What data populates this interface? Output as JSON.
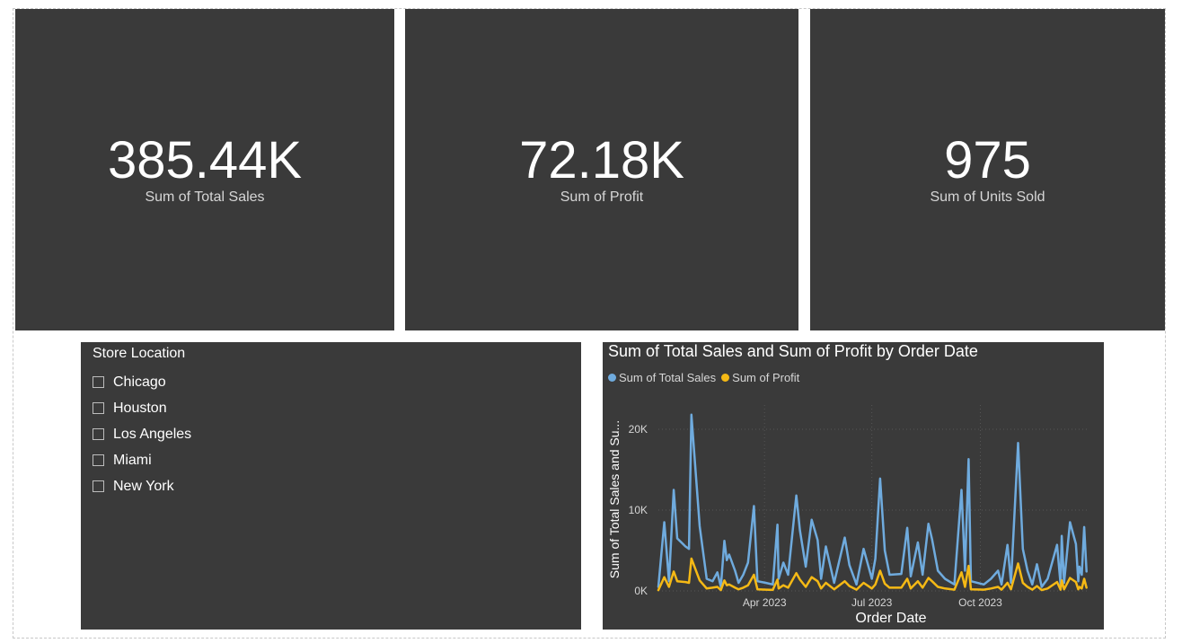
{
  "kpis": [
    {
      "value": "385.44K",
      "label": "Sum of Total Sales"
    },
    {
      "value": "72.18K",
      "label": "Sum of Profit"
    },
    {
      "value": "975",
      "label": "Sum of Units Sold"
    }
  ],
  "slicer": {
    "title": "Store Location",
    "items": [
      "Chicago",
      "Houston",
      "Los Angeles",
      "Miami",
      "New York"
    ]
  },
  "chart": {
    "title": "Sum of Total Sales and Sum of Profit by Order Date",
    "legend": [
      {
        "name": "Sum of Total Sales",
        "color": "#6fabde"
      },
      {
        "name": "Sum of Profit",
        "color": "#f5b915"
      }
    ]
  },
  "chart_data": {
    "type": "line",
    "title": "Sum of Total Sales and Sum of Profit by Order Date",
    "xlabel": "Order Date",
    "ylabel": "Sum of Total Sales and Su...",
    "x_ticks": [
      "Apr 2023",
      "Jul 2023",
      "Oct 2023"
    ],
    "y_ticks": [
      "0K",
      "10K",
      "20K"
    ],
    "ylim": [
      0,
      23000
    ],
    "grid": true,
    "legend_position": "top-left",
    "series": [
      {
        "name": "Sum of Total Sales",
        "color": "#6fabde",
        "points": [
          [
            "2023-01-01",
            500
          ],
          [
            "2023-01-06",
            8500
          ],
          [
            "2023-01-10",
            1200
          ],
          [
            "2023-01-14",
            12500
          ],
          [
            "2023-01-17",
            6500
          ],
          [
            "2023-01-24",
            5500
          ],
          [
            "2023-01-27",
            5200
          ],
          [
            "2023-01-29",
            21800
          ],
          [
            "2023-02-05",
            8000
          ],
          [
            "2023-02-11",
            1500
          ],
          [
            "2023-02-16",
            1200
          ],
          [
            "2023-02-20",
            2300
          ],
          [
            "2023-02-23",
            500
          ],
          [
            "2023-02-26",
            6200
          ],
          [
            "2023-02-28",
            3800
          ],
          [
            "2023-03-02",
            4500
          ],
          [
            "2023-03-07",
            2500
          ],
          [
            "2023-03-10",
            1000
          ],
          [
            "2023-03-14",
            2000
          ],
          [
            "2023-03-18",
            3500
          ],
          [
            "2023-03-23",
            10500
          ],
          [
            "2023-03-26",
            1200
          ],
          [
            "2023-04-02",
            1000
          ],
          [
            "2023-04-08",
            800
          ],
          [
            "2023-04-12",
            8200
          ],
          [
            "2023-04-13",
            1500
          ],
          [
            "2023-04-17",
            3500
          ],
          [
            "2023-04-21",
            2000
          ],
          [
            "2023-04-28",
            11800
          ],
          [
            "2023-05-01",
            7500
          ],
          [
            "2023-05-06",
            3000
          ],
          [
            "2023-05-11",
            8800
          ],
          [
            "2023-05-16",
            6300
          ],
          [
            "2023-05-19",
            1500
          ],
          [
            "2023-05-23",
            5500
          ],
          [
            "2023-05-30",
            1000
          ],
          [
            "2023-06-08",
            6600
          ],
          [
            "2023-06-12",
            3200
          ],
          [
            "2023-06-18",
            800
          ],
          [
            "2023-06-24",
            5200
          ],
          [
            "2023-07-01",
            1500
          ],
          [
            "2023-07-04",
            4000
          ],
          [
            "2023-07-08",
            13900
          ],
          [
            "2023-07-12",
            5000
          ],
          [
            "2023-07-16",
            2000
          ],
          [
            "2023-07-26",
            2100
          ],
          [
            "2023-07-31",
            7800
          ],
          [
            "2023-08-03",
            1800
          ],
          [
            "2023-08-09",
            6000
          ],
          [
            "2023-08-13",
            2000
          ],
          [
            "2023-08-18",
            8300
          ],
          [
            "2023-08-21",
            6400
          ],
          [
            "2023-08-26",
            2500
          ],
          [
            "2023-09-01",
            1500
          ],
          [
            "2023-09-09",
            800
          ],
          [
            "2023-09-15",
            12500
          ],
          [
            "2023-09-18",
            2500
          ],
          [
            "2023-09-21",
            16300
          ],
          [
            "2023-09-23",
            1200
          ],
          [
            "2023-10-04",
            800
          ],
          [
            "2023-10-10",
            1500
          ],
          [
            "2023-10-16",
            2500
          ],
          [
            "2023-10-19",
            800
          ],
          [
            "2023-10-24",
            5700
          ],
          [
            "2023-10-27",
            1000
          ],
          [
            "2023-11-02",
            18300
          ],
          [
            "2023-11-06",
            5200
          ],
          [
            "2023-11-10",
            2500
          ],
          [
            "2023-11-14",
            800
          ],
          [
            "2023-11-18",
            3300
          ],
          [
            "2023-11-22",
            500
          ],
          [
            "2023-11-27",
            1500
          ],
          [
            "2023-12-05",
            5700
          ],
          [
            "2023-12-08",
            800
          ],
          [
            "2023-12-09",
            6800
          ],
          [
            "2023-12-11",
            1000
          ],
          [
            "2023-12-16",
            8500
          ],
          [
            "2023-12-21",
            5800
          ],
          [
            "2023-12-23",
            1200
          ],
          [
            "2023-12-24",
            3000
          ],
          [
            "2023-12-26",
            2000
          ],
          [
            "2023-12-28",
            7900
          ],
          [
            "2023-12-30",
            2400
          ]
        ]
      },
      {
        "name": "Sum of Profit",
        "color": "#f5b915",
        "points": [
          [
            "2023-01-01",
            100
          ],
          [
            "2023-01-06",
            1700
          ],
          [
            "2023-01-10",
            500
          ],
          [
            "2023-01-14",
            2400
          ],
          [
            "2023-01-17",
            1200
          ],
          [
            "2023-01-24",
            1100
          ],
          [
            "2023-01-27",
            1000
          ],
          [
            "2023-01-29",
            4000
          ],
          [
            "2023-02-05",
            1300
          ],
          [
            "2023-02-11",
            300
          ],
          [
            "2023-02-16",
            400
          ],
          [
            "2023-02-20",
            500
          ],
          [
            "2023-02-23",
            100
          ],
          [
            "2023-02-26",
            1300
          ],
          [
            "2023-02-28",
            700
          ],
          [
            "2023-03-02",
            800
          ],
          [
            "2023-03-07",
            400
          ],
          [
            "2023-03-10",
            200
          ],
          [
            "2023-03-14",
            400
          ],
          [
            "2023-03-18",
            700
          ],
          [
            "2023-03-23",
            2000
          ],
          [
            "2023-03-26",
            200
          ],
          [
            "2023-04-02",
            150
          ],
          [
            "2023-04-08",
            120
          ],
          [
            "2023-04-12",
            1400
          ],
          [
            "2023-04-13",
            300
          ],
          [
            "2023-04-17",
            700
          ],
          [
            "2023-04-21",
            400
          ],
          [
            "2023-04-28",
            2200
          ],
          [
            "2023-05-01",
            1400
          ],
          [
            "2023-05-06",
            500
          ],
          [
            "2023-05-11",
            1700
          ],
          [
            "2023-05-16",
            1200
          ],
          [
            "2023-05-19",
            300
          ],
          [
            "2023-05-23",
            1000
          ],
          [
            "2023-05-30",
            200
          ],
          [
            "2023-06-08",
            1200
          ],
          [
            "2023-06-12",
            600
          ],
          [
            "2023-06-18",
            150
          ],
          [
            "2023-06-24",
            1000
          ],
          [
            "2023-07-01",
            300
          ],
          [
            "2023-07-04",
            800
          ],
          [
            "2023-07-08",
            2500
          ],
          [
            "2023-07-12",
            900
          ],
          [
            "2023-07-16",
            400
          ],
          [
            "2023-07-26",
            400
          ],
          [
            "2023-07-31",
            1500
          ],
          [
            "2023-08-03",
            300
          ],
          [
            "2023-08-09",
            1200
          ],
          [
            "2023-08-13",
            400
          ],
          [
            "2023-08-18",
            1600
          ],
          [
            "2023-08-21",
            1200
          ],
          [
            "2023-08-26",
            500
          ],
          [
            "2023-09-01",
            300
          ],
          [
            "2023-09-09",
            150
          ],
          [
            "2023-09-15",
            2300
          ],
          [
            "2023-09-18",
            500
          ],
          [
            "2023-09-21",
            3100
          ],
          [
            "2023-09-23",
            200
          ],
          [
            "2023-10-04",
            150
          ],
          [
            "2023-10-10",
            300
          ],
          [
            "2023-10-16",
            500
          ],
          [
            "2023-10-19",
            150
          ],
          [
            "2023-10-24",
            1000
          ],
          [
            "2023-10-27",
            200
          ],
          [
            "2023-11-02",
            3400
          ],
          [
            "2023-11-06",
            1000
          ],
          [
            "2023-11-10",
            500
          ],
          [
            "2023-11-14",
            150
          ],
          [
            "2023-11-18",
            600
          ],
          [
            "2023-11-22",
            100
          ],
          [
            "2023-11-27",
            300
          ],
          [
            "2023-12-05",
            1100
          ],
          [
            "2023-12-08",
            150
          ],
          [
            "2023-12-09",
            1300
          ],
          [
            "2023-12-11",
            200
          ],
          [
            "2023-12-16",
            1600
          ],
          [
            "2023-12-21",
            1100
          ],
          [
            "2023-12-23",
            200
          ],
          [
            "2023-12-24",
            500
          ],
          [
            "2023-12-26",
            300
          ],
          [
            "2023-12-28",
            1500
          ],
          [
            "2023-12-30",
            400
          ]
        ]
      }
    ]
  }
}
